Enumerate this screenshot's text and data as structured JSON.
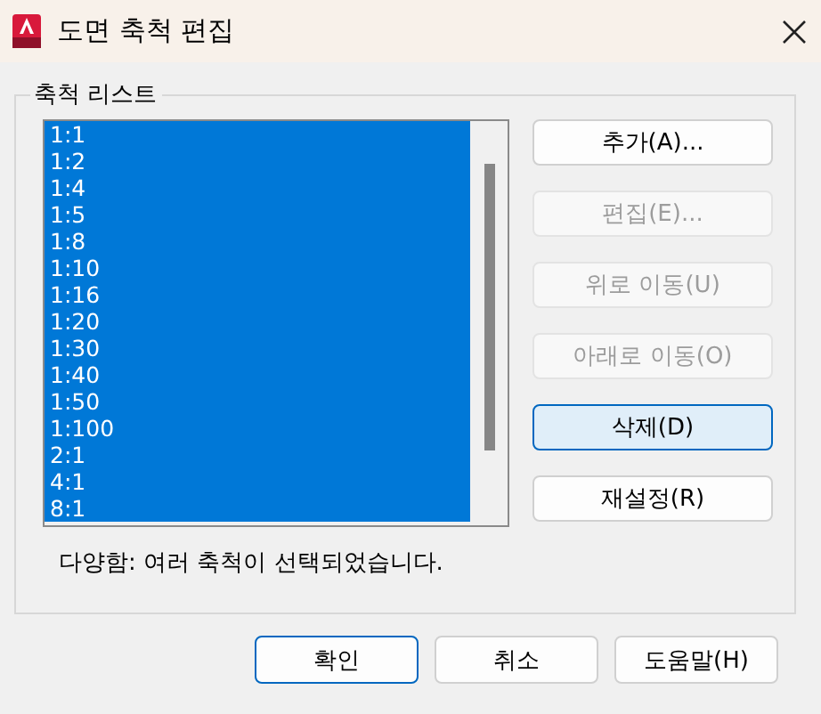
{
  "window": {
    "title": "도면 축척 편집"
  },
  "group": {
    "title": "축척 리스트"
  },
  "scales": [
    {
      "label": "1:1",
      "selected": true
    },
    {
      "label": "1:2",
      "selected": true
    },
    {
      "label": "1:4",
      "selected": true
    },
    {
      "label": "1:5",
      "selected": true
    },
    {
      "label": "1:8",
      "selected": true
    },
    {
      "label": "1:10",
      "selected": true
    },
    {
      "label": "1:16",
      "selected": true
    },
    {
      "label": "1:20",
      "selected": true
    },
    {
      "label": "1:30",
      "selected": true
    },
    {
      "label": "1:40",
      "selected": true
    },
    {
      "label": "1:50",
      "selected": true
    },
    {
      "label": "1:100",
      "selected": true
    },
    {
      "label": "2:1",
      "selected": true
    },
    {
      "label": "4:1",
      "selected": true
    },
    {
      "label": "8:1",
      "selected": true
    }
  ],
  "side_buttons": [
    {
      "label": "추가(A)...",
      "disabled": false,
      "hovered": false
    },
    {
      "label": "편집(E)...",
      "disabled": true,
      "hovered": false
    },
    {
      "label": "위로 이동(U)",
      "disabled": true,
      "hovered": false
    },
    {
      "label": "아래로 이동(O)",
      "disabled": true,
      "hovered": false
    },
    {
      "label": "삭제(D)",
      "disabled": false,
      "hovered": true
    },
    {
      "label": "재설정(R)",
      "disabled": false,
      "hovered": false
    }
  ],
  "status": "다양함: 여러 축척이 선택되었습니다.",
  "buttons": [
    {
      "label": "확인",
      "default": true
    },
    {
      "label": "취소",
      "default": false
    },
    {
      "label": "도움말(H)",
      "default": false
    }
  ]
}
